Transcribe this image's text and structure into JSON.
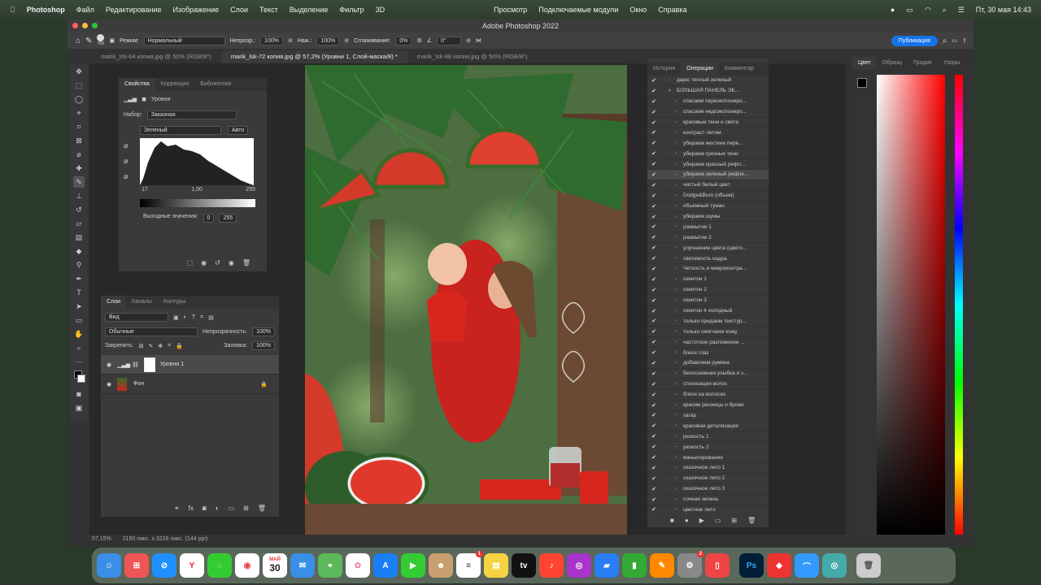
{
  "menubar": {
    "apple": "",
    "app": "Photoshop",
    "items": [
      "Файл",
      "Редактирование",
      "Изображение",
      "Слои",
      "Текст",
      "Выделение",
      "Фильтр",
      "3D",
      "Просмотр",
      "Подключаемые модули",
      "Окно",
      "Справка"
    ],
    "clock": "Пт, 30 мая  14:43"
  },
  "window": {
    "title": "Adobe Photoshop 2022",
    "publish": "Публикация"
  },
  "options": {
    "mode_label": "Режим:",
    "mode": "Нормальный",
    "opacity_label": "Непрозр.:",
    "opacity": "100%",
    "pressure_label": "Наж.:",
    "pressure": "100%",
    "smooth_label": "Сглаживание:",
    "smooth": "0%",
    "angle": "0°",
    "brush_size": "700"
  },
  "tabs": [
    {
      "label": "marik_lsk-64 копия.jpg @ 50% (RGB/8*)"
    },
    {
      "label": "marik_lsk-72 копия.jpg @ 57,2% (Уровни 1, Слой-маска/8) *"
    },
    {
      "label": "marik_lsk-88 копия.jpg @ 50% (RGB/8*)"
    }
  ],
  "properties": {
    "tabs": [
      "Свойства",
      "Коррекция",
      "Библиотеки"
    ],
    "type": "Уровни",
    "preset_label": "Набор:",
    "preset": "Заказная",
    "channel": "Зеленый",
    "auto": "Авто",
    "input": [
      "17",
      "1,00",
      "255"
    ],
    "output_label": "Выходные значения:",
    "output": [
      "0",
      "255"
    ]
  },
  "layers": {
    "tabs": [
      "Слои",
      "Каналы",
      "Контуры"
    ],
    "filter": "Вид",
    "blend": "Обычные",
    "opacity_label": "Непрозрачность:",
    "opacity": "100%",
    "lock_label": "Закрепить:",
    "fill_label": "Заливка:",
    "fill": "100%",
    "items": [
      {
        "name": "Уровни 1"
      },
      {
        "name": "Фон"
      }
    ]
  },
  "actions": {
    "tabs": [
      "История",
      "Операции",
      "Комментар"
    ],
    "items": [
      "дарю теплый зеленый",
      "БОЛЬШАЯ ПАНЕЛЬ ЭК...",
      "спасаем переэкспониро...",
      "спасаем недоэкспониро...",
      "красивые тени и света",
      "контраст летом",
      "убираем  жесткие пере...",
      "убираем грязные тени",
      "убираем красный рефл...",
      "убираем зеленый рефле...",
      "чистый белый цвет",
      "Dodge&Burn (объем)",
      "объемный туман",
      "убираем шумы",
      "размытие 1",
      "размытие 2",
      "улучшение цвета (цвето...",
      "светимость кадра",
      "Четкость и микроконтра...",
      "скинтон 1",
      "скинтон 2",
      "скинтон 3",
      "скинтон 4 холодный",
      "только придаем текстур...",
      "только смягчаем кожу",
      "частотное разложение ...",
      "блеск глаз",
      "добавляем румяна",
      "белоснежная улыбка и з...",
      "стилизация волос",
      "блеск на волосах",
      "красим ресницы и брови",
      "загар",
      "красивая детализация",
      "резкость 1",
      "резкость 2",
      "виньетирование",
      "сказочное лето 1",
      "сказочное лето 2",
      "сказочное лето 3",
      "сочная зелень",
      "цветное лето"
    ]
  },
  "color_panel": {
    "tabs": [
      "Цвет",
      "Образц",
      "Градие",
      "Узоры"
    ]
  },
  "status": {
    "zoom": "57,15%",
    "info": "2150 пикс. x 3226 пикс. (144 ppi)"
  },
  "dock": {
    "calendar_month": "МАЙ",
    "calendar_day": "30",
    "reminders_badge": "1",
    "settings_badge": "2",
    "tv": "tv"
  }
}
